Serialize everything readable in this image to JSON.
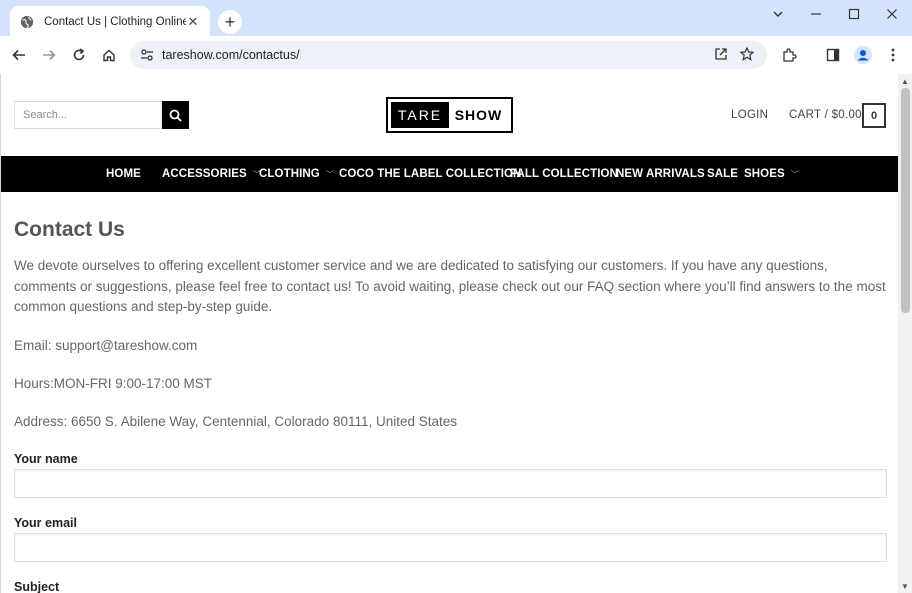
{
  "browser": {
    "tab_title": "Contact Us | Clothing Online",
    "tab_close": "✕",
    "new_tab": "+",
    "url": "tareshow.com/contactus/"
  },
  "header": {
    "search_placeholder": "Search...",
    "logo_left": "TARE",
    "logo_right": "SHOW",
    "login": "LOGIN",
    "cart": "CART / $0.00",
    "cart_count": "0"
  },
  "nav": {
    "items": [
      {
        "label": "HOME"
      },
      {
        "label": "ACCESSORIES"
      },
      {
        "label": "CLOTHING"
      },
      {
        "label": "COCO THE LABEL COLLECTION"
      },
      {
        "label": "FALL COLLECTION"
      },
      {
        "label": "NEW ARRIVALS"
      },
      {
        "label": "SALE"
      },
      {
        "label": "SHOES"
      }
    ]
  },
  "content": {
    "title": "Contact Us",
    "intro": "We devote ourselves to offering excellent customer service and we are dedicated to satisfying our customers. If you have any questions, comments or suggestions, please feel free to contact us! To avoid waiting, please check out our FAQ section where you’ll find answers to the most common questions and step-by-step guide.",
    "email": "Email: support@tareshow.com",
    "hours": "Hours:MON-FRI 9:00-17:00 MST",
    "address": "Address: 6650 S. Abilene Way, Centennial, Colorado 80111, United States"
  },
  "form": {
    "name_label": "Your name",
    "email_label": "Your email",
    "subject_label": "Subject"
  },
  "colors": {
    "titlebar": "#d3e3fd",
    "nav_bg": "#000000"
  }
}
